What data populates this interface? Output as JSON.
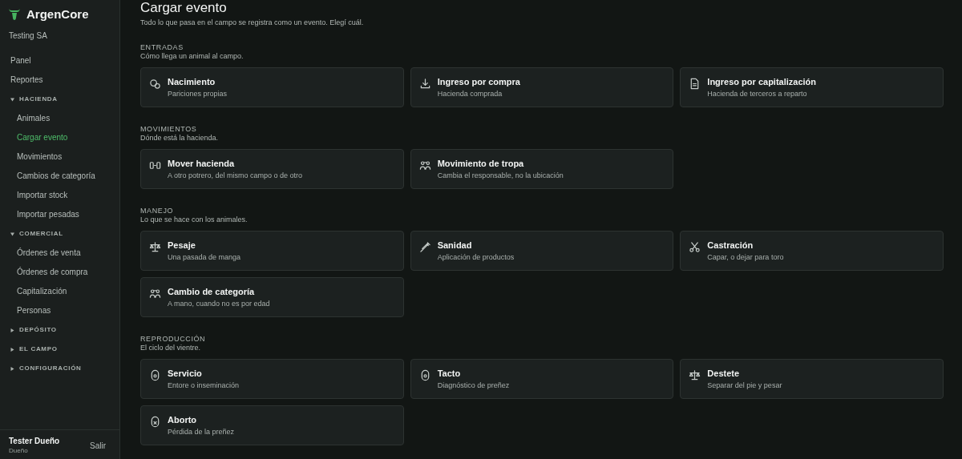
{
  "sidebar": {
    "brand": "ArgenCore",
    "org": "Testing SA",
    "items": [
      {
        "kind": "link",
        "label": "Panel",
        "selected": false
      },
      {
        "kind": "link",
        "label": "Reportes",
        "selected": false
      },
      {
        "kind": "group",
        "label": "HACIENDA",
        "expanded": true,
        "children": [
          {
            "label": "Animales",
            "selected": false
          },
          {
            "label": "Cargar evento",
            "selected": true
          },
          {
            "label": "Movimientos",
            "selected": false
          },
          {
            "label": "Cambios de categoría",
            "selected": false
          },
          {
            "label": "Importar stock",
            "selected": false
          },
          {
            "label": "Importar pesadas",
            "selected": false
          }
        ]
      },
      {
        "kind": "group",
        "label": "COMERCIAL",
        "expanded": true,
        "children": [
          {
            "label": "Órdenes de venta",
            "selected": false
          },
          {
            "label": "Órdenes de compra",
            "selected": false
          },
          {
            "label": "Capitalización",
            "selected": false
          },
          {
            "label": "Personas",
            "selected": false
          }
        ]
      },
      {
        "kind": "group",
        "label": "DEPÓSITO",
        "expanded": false
      },
      {
        "kind": "group",
        "label": "EL CAMPO",
        "expanded": false
      },
      {
        "kind": "group",
        "label": "CONFIGURACIÓN",
        "expanded": false
      }
    ],
    "user": {
      "name": "Tester Dueño",
      "role": "Dueño",
      "logout": "Salir"
    }
  },
  "page": {
    "title": "Cargar evento",
    "subtitle": "Todo lo que pasa en el campo se registra como un evento. Elegí cuál."
  },
  "sections": [
    {
      "title": "ENTRADAS",
      "description": "Cómo llega un animal al campo.",
      "cards": [
        {
          "title": "Nacimiento",
          "description": "Pariciones propias"
        },
        {
          "title": "Ingreso por compra",
          "description": "Hacienda comprada"
        },
        {
          "title": "Ingreso por capitalización",
          "description": "Hacienda de terceros a reparto"
        }
      ]
    },
    {
      "title": "MOVIMIENTOS",
      "description": "Dónde está la hacienda.",
      "cards": [
        {
          "title": "Mover hacienda",
          "description": "A otro potrero, del mismo campo o de otro"
        },
        {
          "title": "Movimiento de tropa",
          "description": "Cambia el responsable, no la ubicación"
        }
      ]
    },
    {
      "title": "MANEJO",
      "description": "Lo que se hace con los animales.",
      "cards": [
        {
          "title": "Pesaje",
          "description": "Una pasada de manga"
        },
        {
          "title": "Sanidad",
          "description": "Aplicación de productos"
        },
        {
          "title": "Castración",
          "description": "Capar, o dejar para toro"
        },
        {
          "title": "Cambio de categoría",
          "description": "A mano, cuando no es por edad"
        }
      ]
    },
    {
      "title": "REPRODUCCIÓN",
      "description": "El ciclo del vientre.",
      "cards": [
        {
          "title": "Servicio",
          "description": "Entore o inseminación"
        },
        {
          "title": "Tacto",
          "description": "Diagnóstico de preñez"
        },
        {
          "title": "Destete",
          "description": "Separar del pie y pesar"
        },
        {
          "title": "Aborto",
          "description": "Pérdida de la preñez"
        }
      ]
    }
  ]
}
